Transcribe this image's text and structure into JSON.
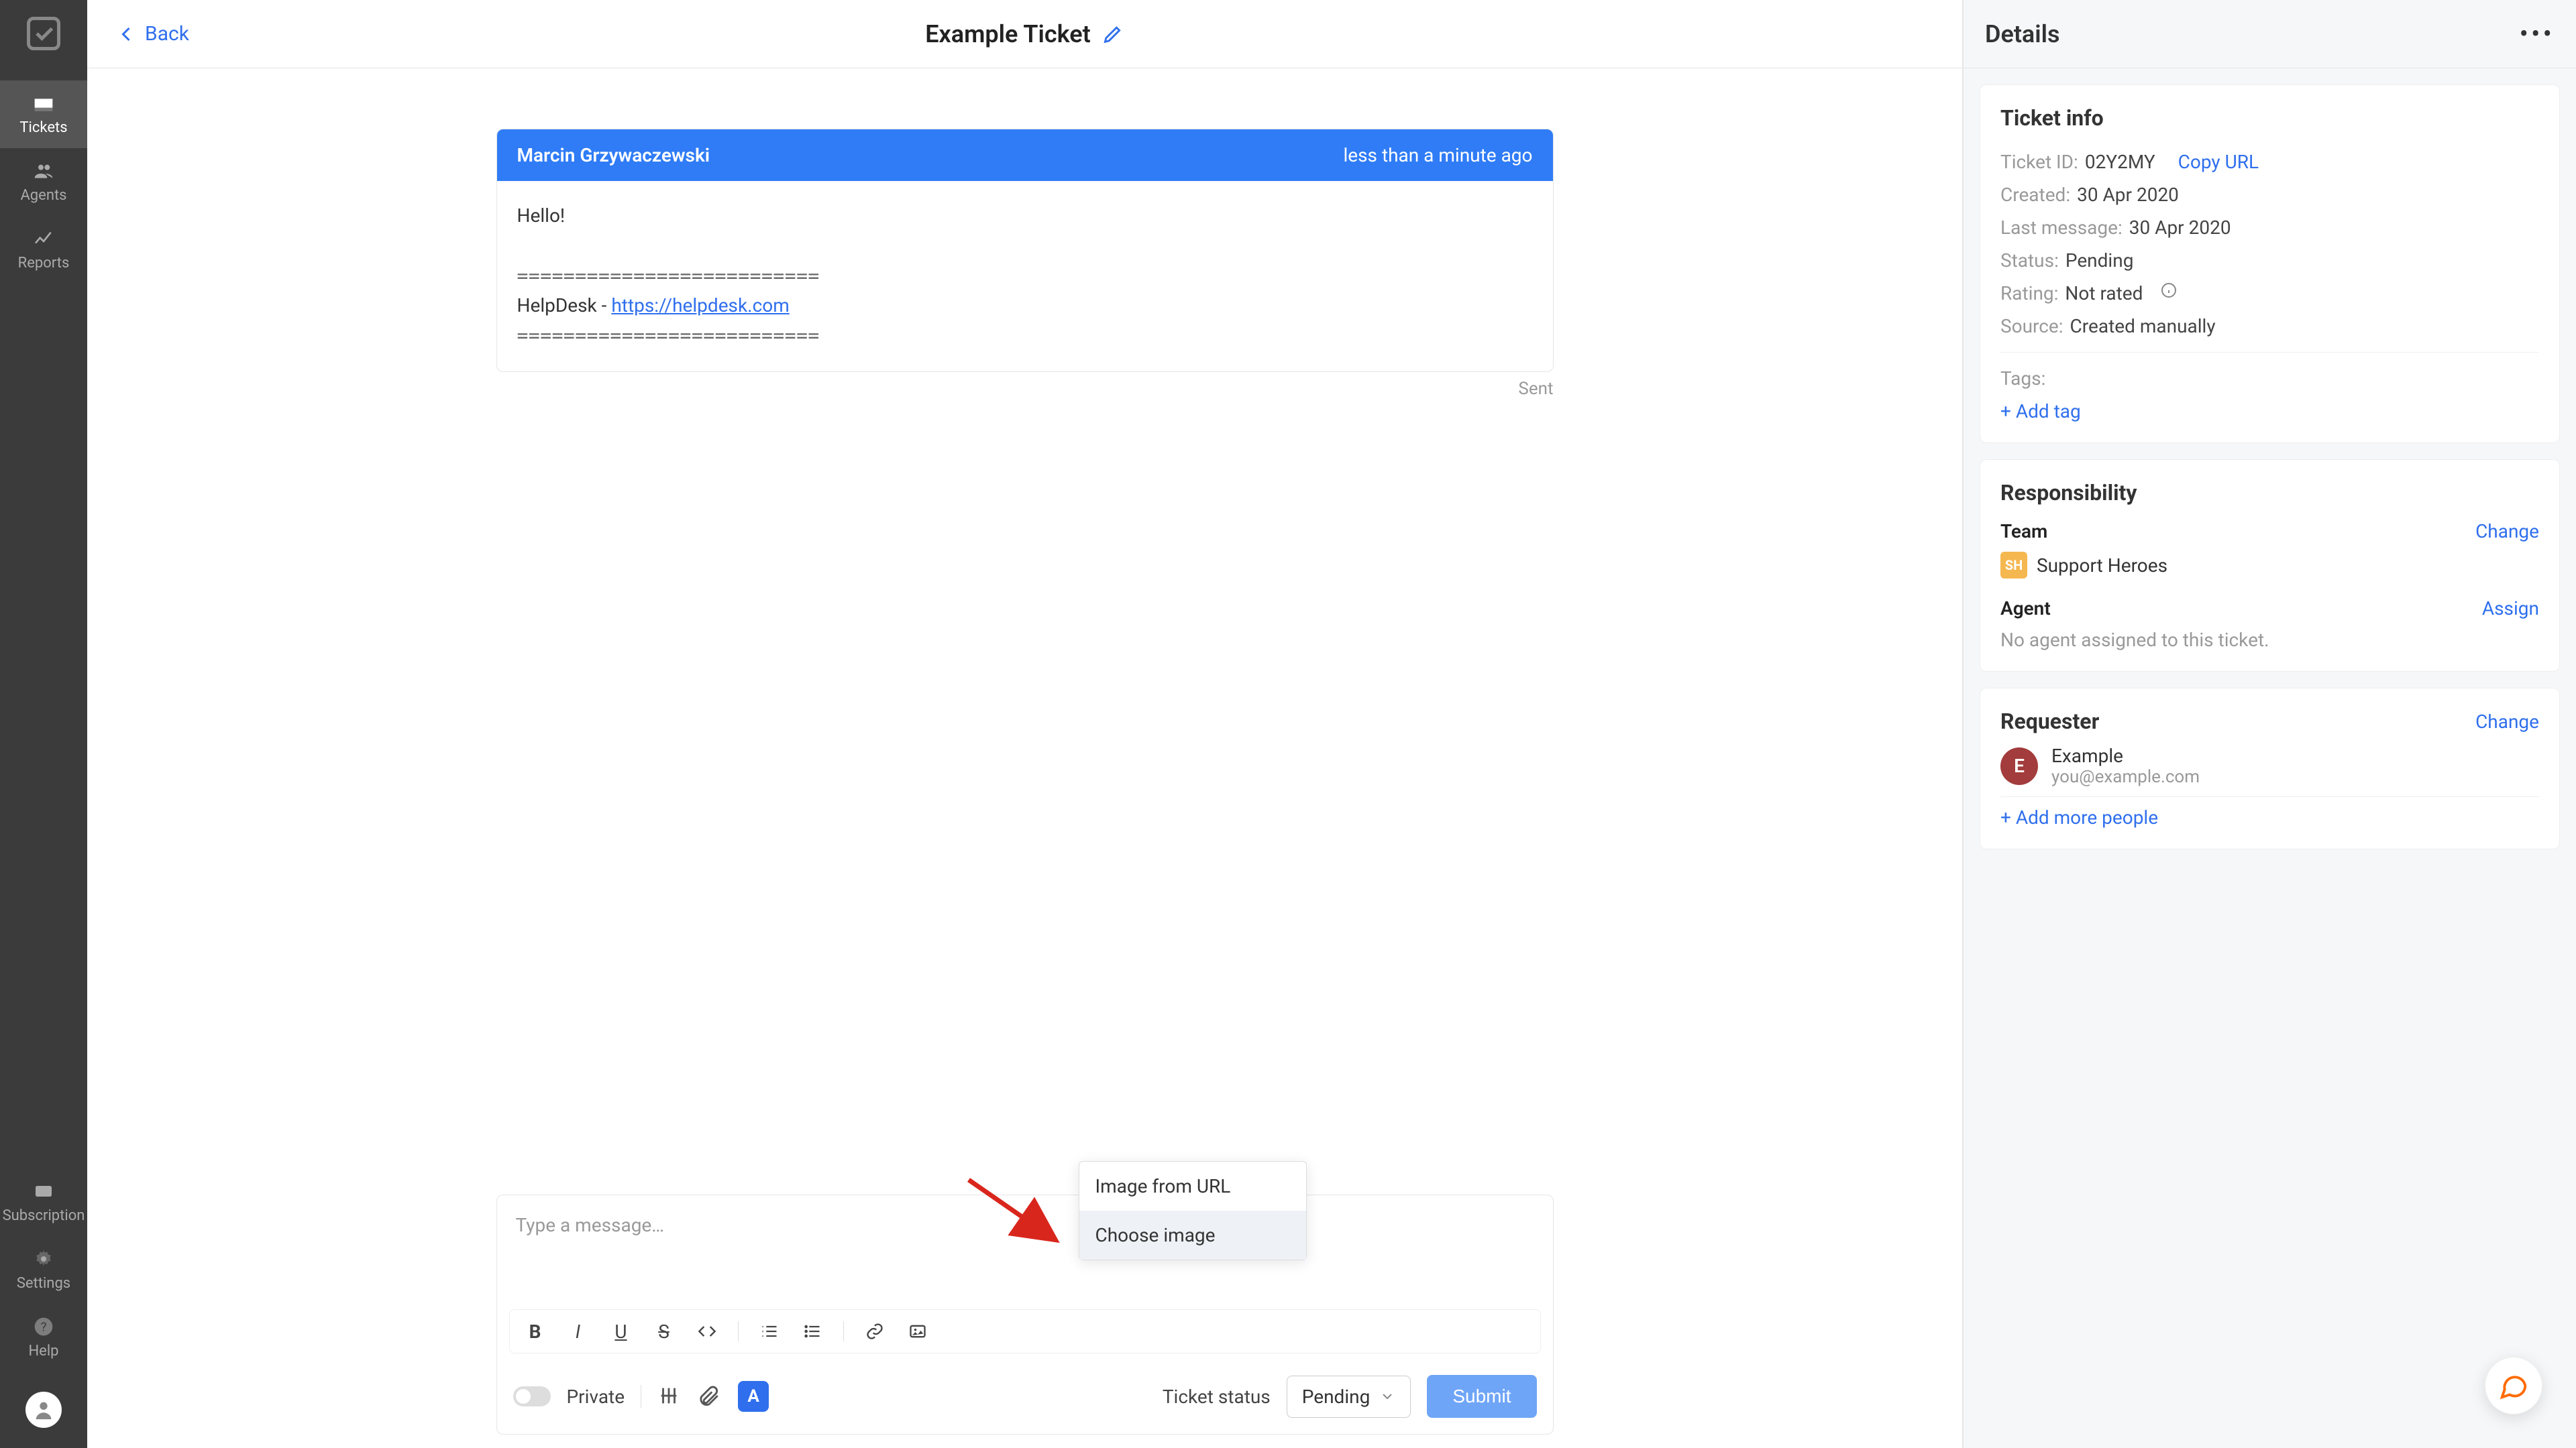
{
  "rail": {
    "items": [
      {
        "label": "Tickets"
      },
      {
        "label": "Agents"
      },
      {
        "label": "Reports"
      }
    ],
    "bottom": [
      {
        "label": "Subscription"
      },
      {
        "label": "Settings"
      },
      {
        "label": "Help"
      }
    ]
  },
  "header": {
    "back": "Back",
    "title": "Example Ticket"
  },
  "message": {
    "author": "Marcin Grzywaczewski",
    "time": "less than a minute ago",
    "greeting": "Hello!",
    "sep": "==========================",
    "sig_prefix": "HelpDesk - ",
    "sig_link": "https://helpdesk.com",
    "status": "Sent"
  },
  "composer": {
    "placeholder": "Type a message…",
    "private": "Private",
    "ticket_status_label": "Ticket status",
    "ticket_status_value": "Pending",
    "submit": "Submit",
    "a_btn": "A"
  },
  "popup": {
    "url": "Image from URL",
    "choose": "Choose image"
  },
  "details": {
    "title": "Details",
    "info": {
      "heading": "Ticket info",
      "ticket_id_label": "Ticket ID:",
      "ticket_id": "02Y2MY",
      "copy_url": "Copy URL",
      "created_label": "Created:",
      "created": "30 Apr 2020",
      "last_msg_label": "Last message:",
      "last_msg": "30 Apr 2020",
      "status_label": "Status:",
      "status": "Pending",
      "rating_label": "Rating:",
      "rating": "Not rated",
      "source_label": "Source:",
      "source": "Created manually",
      "tags_label": "Tags:",
      "add_tag": "+ Add tag"
    },
    "resp": {
      "heading": "Responsibility",
      "team_label": "Team",
      "team_name": "Support Heroes",
      "team_badge": "SH",
      "change": "Change",
      "agent_label": "Agent",
      "assign": "Assign",
      "no_agent": "No agent assigned to this ticket."
    },
    "req": {
      "heading": "Requester",
      "change": "Change",
      "initial": "E",
      "name": "Example",
      "email": "you@example.com",
      "add_more": "+ Add more people"
    }
  }
}
